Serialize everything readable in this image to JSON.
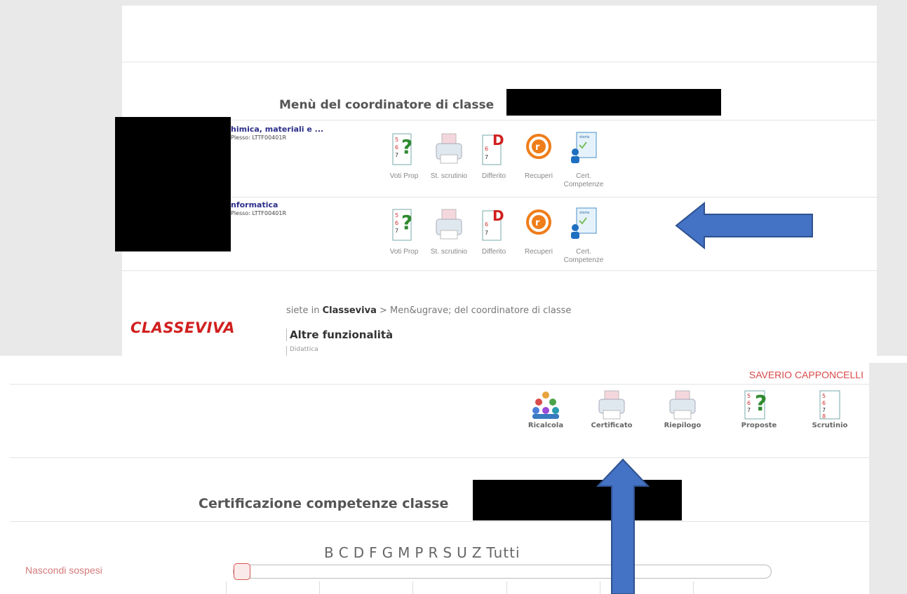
{
  "top": {
    "menu_title": "Menù del coordinatore di classe",
    "classes": [
      {
        "name": "himica, materiali e ...",
        "plesso": "Plesso: LTTF00401R"
      },
      {
        "name": "nformatica",
        "plesso": "Plesso: LTTF00401R"
      }
    ],
    "actions": [
      {
        "label": "Voti Prop",
        "icon": "voti-prop-icon"
      },
      {
        "label": "St. scrutinio",
        "icon": "printer-icon"
      },
      {
        "label": "Differito",
        "icon": "differito-icon"
      },
      {
        "label": "Recuperi",
        "icon": "recuperi-icon"
      },
      {
        "label": "Cert. Competenze",
        "icon": "certificate-icon"
      }
    ],
    "breadcrumb_prefix": "siete in",
    "breadcrumb_root": "Classeviva",
    "breadcrumb_rest": "> Men&ugrave; del coordinatore di classe",
    "altre": "Altre funzionalità",
    "didattica": "Didattica",
    "logo": "CLASSEVIVA"
  },
  "bottom": {
    "user_name": "SAVERIO CAPPONCELLI",
    "toolbar": [
      {
        "label": "Ricalcola",
        "icon": "people-group-icon"
      },
      {
        "label": "Certificato",
        "icon": "printer-icon"
      },
      {
        "label": "Riepilogo",
        "icon": "printer-icon"
      },
      {
        "label": "Proposte",
        "icon": "proposte-icon"
      },
      {
        "label": "Scrutinio",
        "icon": "scrutinio-icon"
      }
    ],
    "cert_title": "Certificazione competenze classe",
    "letters": [
      "B",
      "C",
      "D",
      "F",
      "G",
      "M",
      "P",
      "R",
      "S",
      "U",
      "Z",
      "Tutti"
    ],
    "nascondi": "Nascondi sospesi"
  },
  "colors": {
    "brand_red": "#d11f1f",
    "arrow_blue": "#4472c4",
    "title_gray": "#555555"
  }
}
